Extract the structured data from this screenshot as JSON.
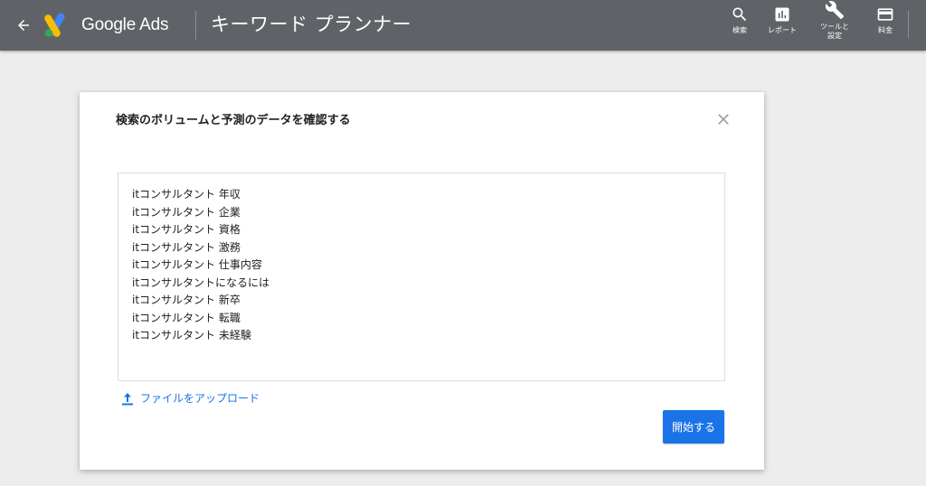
{
  "header": {
    "brand": "Google Ads",
    "page_title": "キーワード プランナー",
    "nav": [
      {
        "label": "検索",
        "icon": "search-icon"
      },
      {
        "label": "レポート",
        "icon": "report-icon"
      },
      {
        "label": "ツールと\n設定",
        "icon": "wrench-icon"
      },
      {
        "label": "料金",
        "icon": "billing-card-icon"
      }
    ]
  },
  "dialog": {
    "title": "検索のボリュームと予測のデータを確認する",
    "keywords_text": "itコンサルタント 年収\nitコンサルタント 企業\nitコンサルタント 資格\nitコンサルタント 激務\nitコンサルタント 仕事内容\nitコンサルタントになるには\nitコンサルタント 新卒\nitコンサルタント 転職\nitコンサルタント 未経験",
    "upload_label": "ファイルをアップロード",
    "start_label": "開始する"
  },
  "colors": {
    "header_bg": "#5f6368",
    "accent": "#1a73e8",
    "page_bg": "#ececec"
  }
}
